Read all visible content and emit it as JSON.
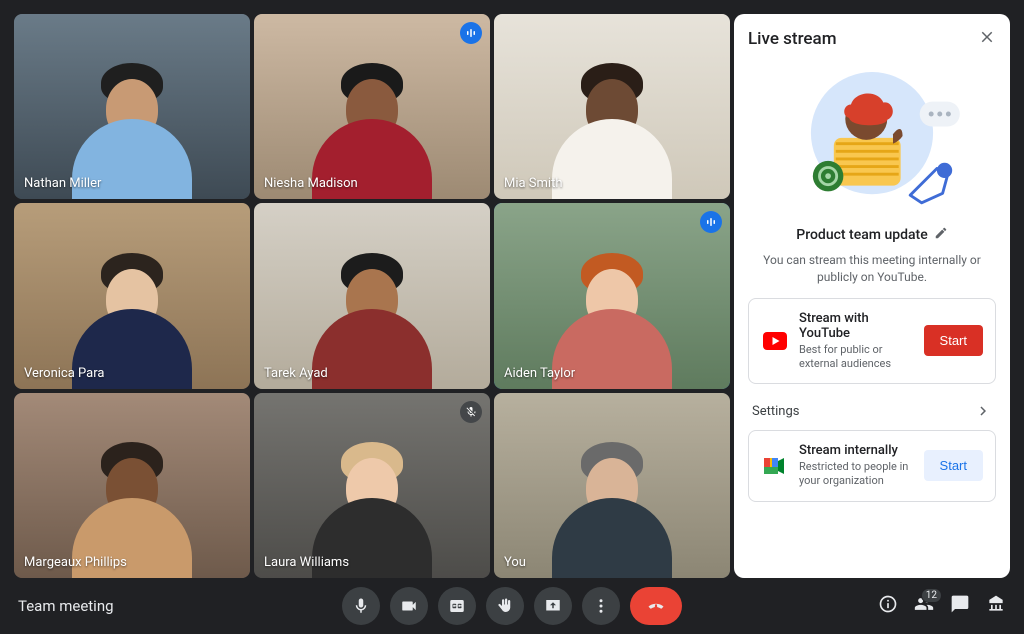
{
  "meeting": {
    "title": "Team meeting",
    "participant_count_badge": "12"
  },
  "participants": [
    {
      "name": "Nathan Miller",
      "speaking": false,
      "muted": false,
      "bg": [
        "#6a7b88",
        "#3e4a54"
      ],
      "shirt": "#82b4e0",
      "hair": "#1f1f1f",
      "skin": "#c89a74"
    },
    {
      "name": "Niesha Madison",
      "speaking": true,
      "muted": false,
      "bg": [
        "#cdb9a3",
        "#9d8a73"
      ],
      "shirt": "#a31f2e",
      "hair": "#1a1a1a",
      "skin": "#8a5a3e"
    },
    {
      "name": "Mia Smith",
      "speaking": false,
      "muted": false,
      "bg": [
        "#e7e3da",
        "#cfc8b9"
      ],
      "shirt": "#f5f2ec",
      "hair": "#2a1e17",
      "skin": "#6d4a34"
    },
    {
      "name": "Veronica Para",
      "speaking": false,
      "muted": false,
      "bg": [
        "#b79d7a",
        "#8d7456"
      ],
      "shirt": "#1e284b",
      "hair": "#2c241e",
      "skin": "#e5c3a2"
    },
    {
      "name": "Tarek Ayad",
      "speaking": false,
      "muted": false,
      "bg": [
        "#d5d0c6",
        "#b3ab9b"
      ],
      "shirt": "#8b2f2d",
      "hair": "#1c1c1c",
      "skin": "#a9754e"
    },
    {
      "name": "Aiden Taylor",
      "speaking": true,
      "muted": false,
      "bg": [
        "#8aa489",
        "#5f7b5e"
      ],
      "shirt": "#c96a61",
      "hair": "#c25a22",
      "skin": "#eec7a8"
    },
    {
      "name": "Margeaux Phillips",
      "speaking": false,
      "muted": false,
      "bg": [
        "#a38a78",
        "#6e5a4b"
      ],
      "shirt": "#c99a6b",
      "hair": "#2b221c",
      "skin": "#7a5034"
    },
    {
      "name": "Laura Williams",
      "speaking": false,
      "muted": true,
      "bg": [
        "#757470",
        "#4d4c49"
      ],
      "shirt": "#2d2d2d",
      "hair": "#d9b98c",
      "skin": "#eec9aa"
    },
    {
      "name": "You",
      "speaking": false,
      "muted": false,
      "bg": [
        "#b7b09e",
        "#8c8674"
      ],
      "shirt": "#2f3b45",
      "hair": "#6a6a6a",
      "skin": "#d9b497"
    }
  ],
  "panel": {
    "title": "Live stream",
    "stream_name": "Product team update",
    "subhead": "You can stream this meeting internally or publicly on YouTube.",
    "youtube": {
      "title": "Stream with YouTube",
      "sub": "Best for public or external audiences",
      "button": "Start"
    },
    "settings_label": "Settings",
    "internal": {
      "title": "Stream internally",
      "sub": "Restricted to people in your organization",
      "button": "Start"
    }
  }
}
